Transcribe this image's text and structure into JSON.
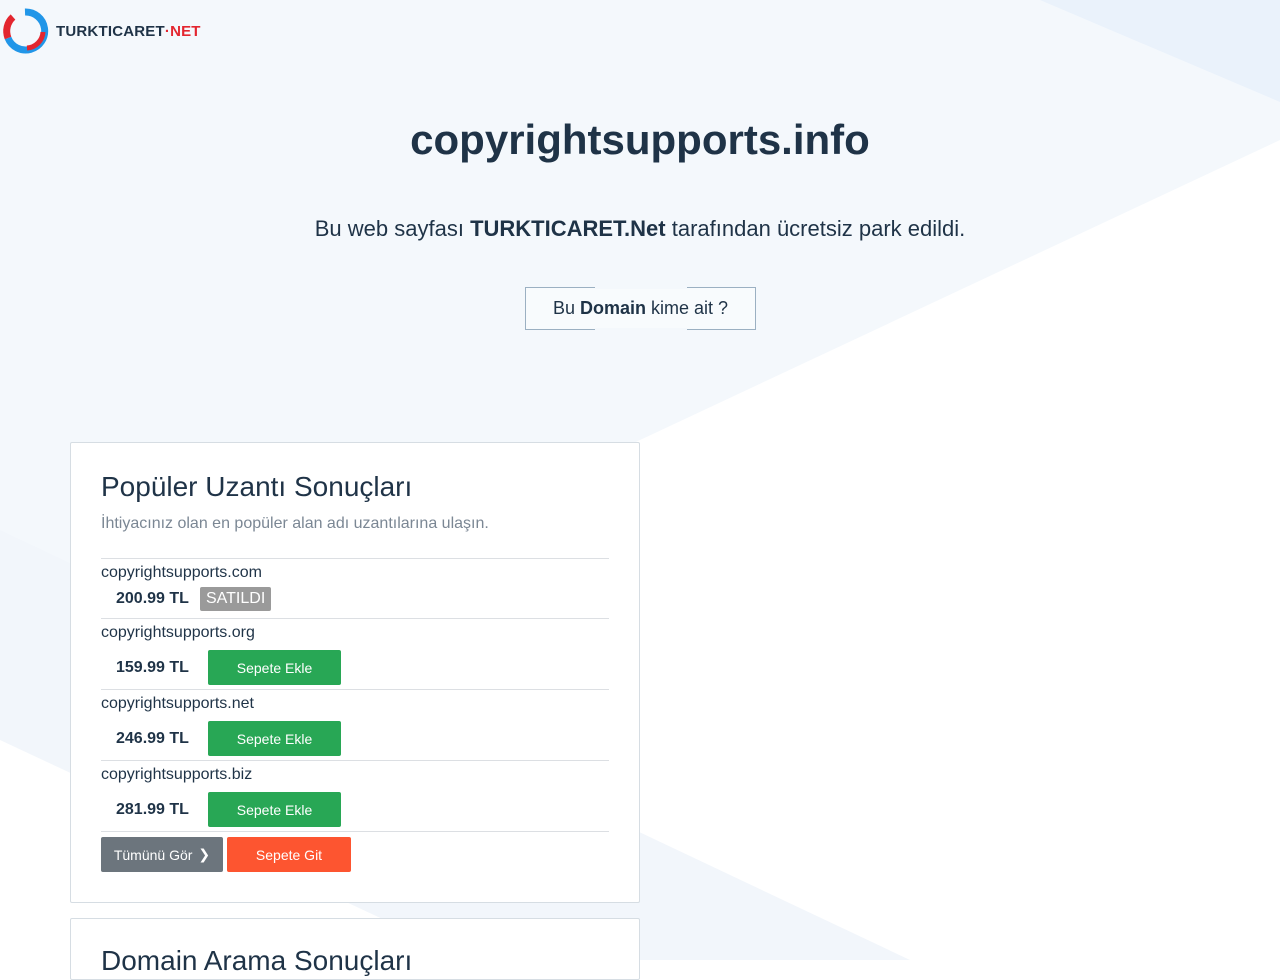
{
  "brand": {
    "logo_text_main": "TURKTICARET",
    "logo_text_sep": "·",
    "logo_text_suffix": "NET",
    "colors": {
      "accent_blue": "#2196e8",
      "accent_red": "#e3262f",
      "dark_text": "#1f3347"
    }
  },
  "hero": {
    "domain_title": "copyrightsupports.info",
    "parked_prefix": "Bu web sayfası",
    "parked_brand": "TURKTICARET.Net",
    "parked_suffix": "tarafından ücretsiz park edildi.",
    "whois_prefix": "Bu",
    "whois_bold": "Domain",
    "whois_suffix": "kime ait ?"
  },
  "popular": {
    "title": "Popüler Uzantı Sonuçları",
    "subtitle": "İhtiyacınız olan en popüler alan adı uzantılarına ulaşın.",
    "items": [
      {
        "domain": "copyrightsupports.com",
        "price": "200.99 TL",
        "status": "SATILDI"
      },
      {
        "domain": "copyrightsupports.org",
        "price": "159.99 TL",
        "action": "Sepete Ekle"
      },
      {
        "domain": "copyrightsupports.net",
        "price": "246.99 TL",
        "action": "Sepete Ekle"
      },
      {
        "domain": "copyrightsupports.biz",
        "price": "281.99 TL",
        "action": "Sepete Ekle"
      }
    ],
    "see_all_label": "Tümünü Gör",
    "go_cart_label": "Sepete Git",
    "colors": {
      "add": "#28a755",
      "see_all": "#6c757d",
      "cart": "#fd5530",
      "sold": "#9a9a9a"
    }
  },
  "search_results": {
    "title": "Domain Arama Sonuçları"
  }
}
